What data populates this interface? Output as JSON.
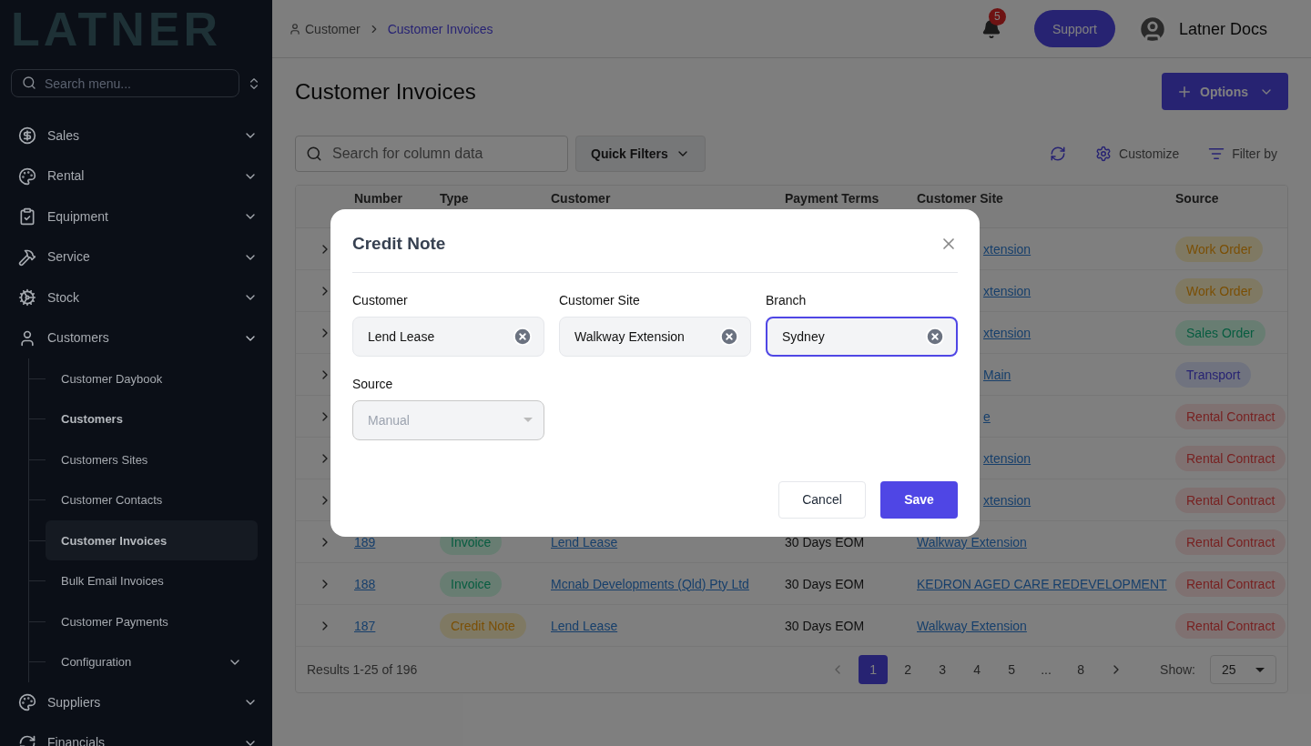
{
  "sidebar": {
    "logo": "LATNER",
    "search": {
      "placeholder": "Search menu..."
    },
    "items": [
      {
        "label": "Sales",
        "expanded": false
      },
      {
        "label": "Rental",
        "expanded": false
      },
      {
        "label": "Equipment",
        "expanded": false
      },
      {
        "label": "Service",
        "expanded": false
      },
      {
        "label": "Stock",
        "expanded": false
      },
      {
        "label": "Customers",
        "expanded": true,
        "children": [
          {
            "label": "Customer Daybook",
            "selected": false,
            "active": false
          },
          {
            "label": "Customers",
            "selected": false,
            "active": true
          },
          {
            "label": "Customers Sites",
            "selected": false,
            "active": false
          },
          {
            "label": "Customer Contacts",
            "selected": false,
            "active": false
          },
          {
            "label": "Customer Invoices",
            "selected": true,
            "active": true
          },
          {
            "label": "Bulk Email Invoices",
            "selected": false,
            "active": false
          },
          {
            "label": "Customer Payments",
            "selected": false,
            "active": false
          },
          {
            "label": "Configuration",
            "selected": false,
            "active": false,
            "expandable": true
          }
        ]
      },
      {
        "label": "Suppliers",
        "expanded": false
      },
      {
        "label": "Financials",
        "expanded": false
      }
    ]
  },
  "header": {
    "breadcrumb": [
      "Customer",
      "Customer Invoices"
    ],
    "notifications": "5",
    "support": "Support",
    "user": "Latner Docs"
  },
  "page": {
    "title": "Customer Invoices",
    "options": "Options",
    "search": {
      "placeholder": "Search for column data"
    },
    "quick_filters": "Quick Filters",
    "customize": "Customize",
    "filter_by": "Filter by"
  },
  "table": {
    "columns": [
      "Number",
      "Type",
      "Customer",
      "Payment Terms",
      "Customer Site",
      "Source"
    ],
    "rows": [
      {
        "site": "xtension",
        "source": {
          "label": "Work Order",
          "kind": "warning"
        }
      },
      {
        "site": "xtension",
        "source": {
          "label": "Work Order",
          "kind": "warning"
        }
      },
      {
        "site": "xtension",
        "source": {
          "label": "Sales Order",
          "kind": "success"
        }
      },
      {
        "site": "Main",
        "source": {
          "label": "Transport",
          "kind": "info"
        }
      },
      {
        "site": "e",
        "source": {
          "label": "Rental Contract",
          "kind": "danger"
        }
      },
      {
        "site": "xtension",
        "source": {
          "label": "Rental Contract",
          "kind": "danger"
        }
      },
      {
        "site": "xtension",
        "source": {
          "label": "Rental Contract",
          "kind": "danger"
        }
      },
      {
        "number": "189",
        "type": {
          "label": "Invoice",
          "kind": "success"
        },
        "customer": "Lend Lease",
        "terms": "30 Days EOM",
        "site": "Walkway Extension",
        "source": {
          "label": "Rental Contract",
          "kind": "danger"
        }
      },
      {
        "number": "188",
        "type": {
          "label": "Invoice",
          "kind": "success"
        },
        "customer": "Mcnab Developments (Qld) Pty Ltd",
        "terms": "30 Days EOM",
        "site": "KEDRON AGED CARE REDEVELOPMENT",
        "source": {
          "label": "Rental Contract",
          "kind": "danger"
        }
      },
      {
        "number": "187",
        "type": {
          "label": "Credit Note",
          "kind": "warning"
        },
        "customer": "Lend Lease",
        "terms": "30 Days EOM",
        "site": "Walkway Extension",
        "source": {
          "label": "Rental Contract",
          "kind": "danger"
        }
      }
    ],
    "results": "Results 1-25 of 196",
    "pages": [
      {
        "label": "1",
        "selected": true
      },
      {
        "label": "2",
        "selected": false
      },
      {
        "label": "3",
        "selected": false
      },
      {
        "label": "4",
        "selected": false
      },
      {
        "label": "5",
        "selected": false
      },
      {
        "label": "...",
        "selected": false
      },
      {
        "label": "8",
        "selected": false
      }
    ],
    "show_label": "Show:",
    "page_size": "25"
  },
  "dialog": {
    "title": "Credit Note",
    "fields": [
      {
        "label": "Customer",
        "value": "Lend Lease",
        "kind": "clearable",
        "focused": false
      },
      {
        "label": "Customer Site",
        "value": "Walkway Extension",
        "kind": "clearable",
        "focused": false
      },
      {
        "label": "Branch",
        "value": "Sydney",
        "kind": "clearable",
        "focused": true
      },
      {
        "label": "Source",
        "value": "Manual",
        "kind": "select",
        "disabled": true
      }
    ],
    "buttons": [
      {
        "label": "Cancel",
        "kind": "secondary"
      },
      {
        "label": "Save",
        "kind": "primary"
      }
    ]
  }
}
